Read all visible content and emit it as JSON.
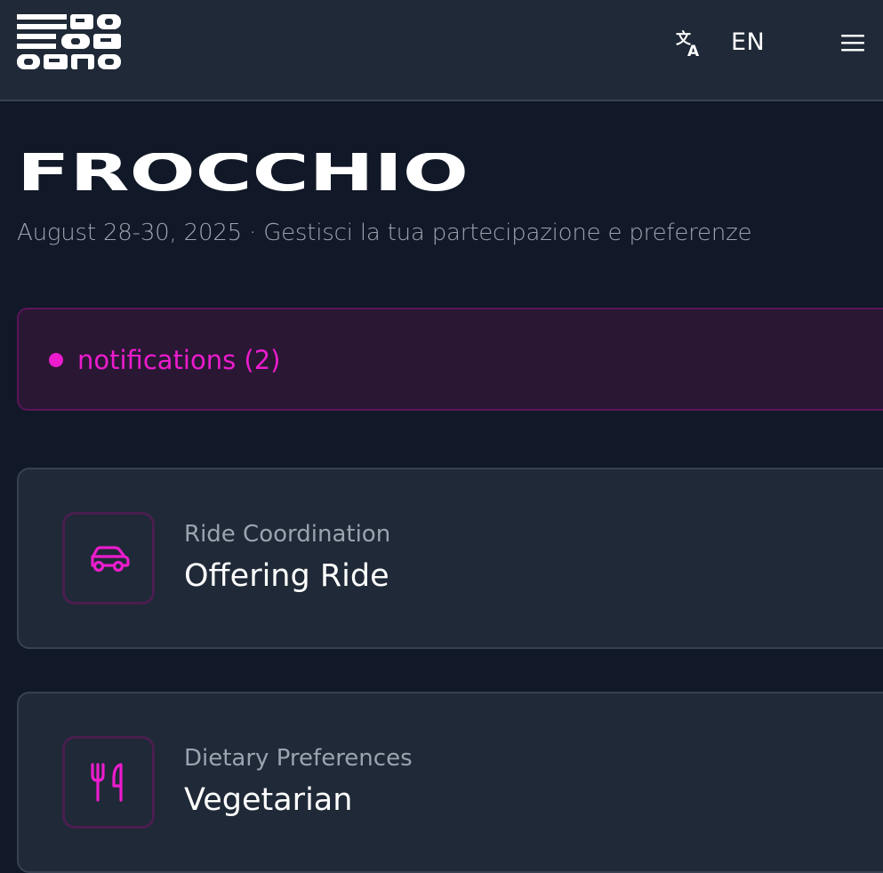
{
  "header": {
    "logo_text": [
      "RO",
      "OR",
      "ORNO"
    ],
    "lang_icon": "translate-icon",
    "language": "EN",
    "menu_icon": "hamburger-menu-icon"
  },
  "page": {
    "title": "FROCCHIO",
    "subtitle": "August 28-30, 2025 · Gestisci la tua partecipazione e preferenze"
  },
  "notifications": {
    "label": "notifications (2)",
    "accent": "#ec1ccd"
  },
  "cards": [
    {
      "icon": "car-icon",
      "label": "Ride Coordination",
      "value": "Offering Ride"
    },
    {
      "icon": "utensils-icon",
      "label": "Dietary Preferences",
      "value": "Vegetarian"
    }
  ],
  "colors": {
    "background": "#111827",
    "surface": "#1f2937",
    "accent": "#ec1ccd",
    "muted_text": "#9ca3af"
  }
}
